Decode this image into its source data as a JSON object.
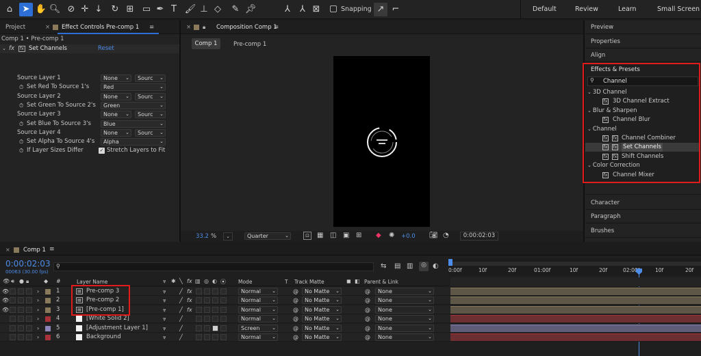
{
  "toolbar": {
    "snapping_label": "Snapping",
    "workspaces": [
      "Default",
      "Review",
      "Learn",
      "Small Screen"
    ]
  },
  "left_panel": {
    "tabs": {
      "project": "Project",
      "effect_controls": "Effect Controls Pre-comp 1"
    },
    "breadcrumb": "Comp 1 • Pre-comp 1",
    "effect": {
      "fx": "fx",
      "name": "Set Channels",
      "reset": "Reset"
    },
    "rows": [
      {
        "label": "Source Layer 1",
        "stopwatch": false,
        "dd1": "None",
        "dd2": "Sourc"
      },
      {
        "label": "Set Red To Source 1's",
        "stopwatch": true,
        "dd": "Red"
      },
      {
        "label": "Source Layer 2",
        "stopwatch": false,
        "dd1": "None",
        "dd2": "Sourc"
      },
      {
        "label": "Set Green To Source 2's",
        "stopwatch": true,
        "dd": "Green"
      },
      {
        "label": "Source Layer 3",
        "stopwatch": false,
        "dd1": "None",
        "dd2": "Sourc"
      },
      {
        "label": "Set Blue To Source 3's",
        "stopwatch": true,
        "dd": "Blue"
      },
      {
        "label": "Source Layer 4",
        "stopwatch": false,
        "dd1": "None",
        "dd2": "Sourc"
      },
      {
        "label": "Set Alpha To Source 4's",
        "stopwatch": true,
        "dd": "Alpha"
      },
      {
        "label": "If Layer Sizes Differ",
        "stopwatch": true,
        "checkbox": "Stretch Layers to Fit"
      }
    ]
  },
  "composition": {
    "tab": "Composition Comp 1",
    "breadcrumbs": [
      "Comp 1",
      "Pre-comp 1"
    ],
    "zoom": "33.2",
    "zoom_unit": "%",
    "resolution": "Quarter",
    "exposure": "+0.0",
    "timecode": "0:00:02:03"
  },
  "right_panel": {
    "top_items": [
      "Preview",
      "Properties",
      "Align"
    ],
    "effects_title": "Effects & Presets",
    "search_value": "Channel",
    "tree": [
      {
        "group": "3D Channel",
        "items": [
          "3D Channel Extract"
        ]
      },
      {
        "group": "Blur & Sharpen",
        "items": [
          "Channel Blur"
        ]
      },
      {
        "group": "Channel",
        "items": [
          "Channel Combiner",
          "Set Channels",
          "Shift Channels"
        ]
      },
      {
        "group": "Color Correction",
        "items": [
          "Channel Mixer"
        ]
      }
    ],
    "bottom_items": [
      "Character",
      "Paragraph",
      "Brushes"
    ]
  },
  "timeline": {
    "tab": "Comp 1",
    "timecode": "0:00:02:03",
    "frames": "00063 (30.00 fps)",
    "headers": {
      "layer_name": "Layer Name",
      "mode": "Mode",
      "t": "T",
      "track_matte": "Track Matte",
      "parent": "Parent & Link"
    },
    "ruler": [
      "0:00f",
      "10f",
      "20f",
      "01:00f",
      "10f",
      "20f",
      "02:00f",
      "10f",
      "20f"
    ],
    "layers": [
      {
        "num": "1",
        "name": "Pre-comp 3",
        "mode": "Normal",
        "matte": "No Matte",
        "parent": "None",
        "color": "#8a7a5c",
        "eye": true,
        "precomp": true
      },
      {
        "num": "2",
        "name": "Pre-comp 2",
        "mode": "Normal",
        "matte": "No Matte",
        "parent": "None",
        "color": "#8a7a5c",
        "eye": true,
        "precomp": true
      },
      {
        "num": "3",
        "name": "[Pre-comp 1]",
        "mode": "Normal",
        "matte": "No Matte",
        "parent": "None",
        "color": "#8a7a5c",
        "eye": true,
        "precomp": true
      },
      {
        "num": "4",
        "name": "[White Solid 2]",
        "mode": "Normal",
        "matte": "No Matte",
        "parent": "None",
        "color": "#a8323a",
        "eye": false,
        "precomp": false
      },
      {
        "num": "5",
        "name": "[Adjustment Layer 1]",
        "mode": "Screen",
        "matte": "No Matte",
        "parent": "None",
        "color": "#8c86b8",
        "eye": false,
        "precomp": false
      },
      {
        "num": "6",
        "name": "Background",
        "mode": "Normal",
        "matte": "No Matte",
        "parent": "None",
        "color": "#a8323a",
        "eye": false,
        "precomp": false
      }
    ]
  }
}
